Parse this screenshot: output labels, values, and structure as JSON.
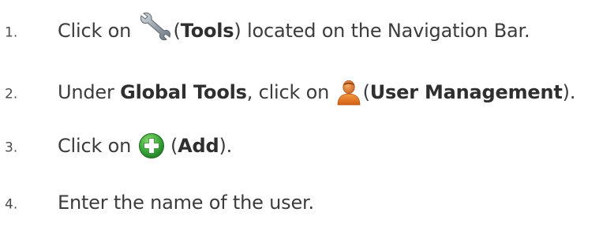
{
  "steps": [
    {
      "number": "1.",
      "before": "Click on ",
      "icon": "wrench-icon",
      "paren_open": "(",
      "bold": "Tools",
      "after": ") located on the Navigation Bar."
    },
    {
      "number": "2.",
      "before": "Under ",
      "bold_section": "Global Tools",
      "middle": ", click on ",
      "icon": "user-icon",
      "paren_open": "(",
      "bold": "User Management",
      "after": ")."
    },
    {
      "number": "3.",
      "before": "Click on ",
      "icon": "add-icon",
      "paren_open": " (",
      "bold": "Add",
      "after": ")."
    },
    {
      "number": "4.",
      "text": "Enter the name of the user."
    }
  ],
  "colors": {
    "text": "#3c3c3c",
    "wrench": "#9aa3ab",
    "user_body": "#f0892a",
    "user_head": "#d9742a",
    "add_green": "#3aa53a"
  }
}
